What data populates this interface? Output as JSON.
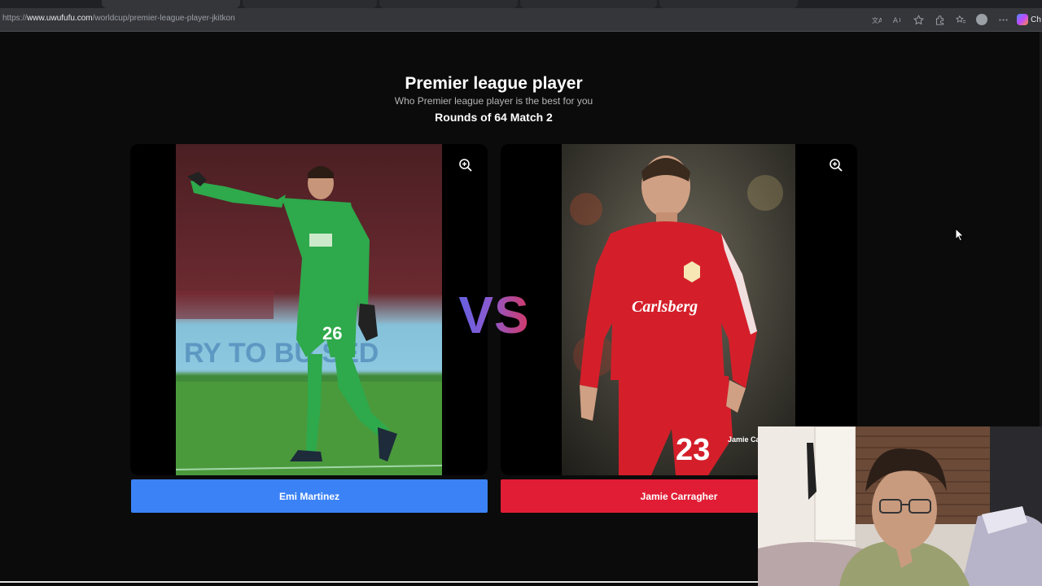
{
  "browser": {
    "url_prefix": "https://",
    "url_host": "www.uwufufu.com",
    "url_path": "/worldcup/premier-league-player-jkitkon",
    "copilot_label": "Ch"
  },
  "header": {
    "title": "Premier league player",
    "subtitle": "Who Premier league player is the best for you",
    "round": "Rounds of 64 Match 2"
  },
  "vs_label": "VS",
  "candidates": [
    {
      "name": "Emi Martinez",
      "shirt_number": "26",
      "kit_color": "#2ea94b",
      "button_color": "#3b82f6"
    },
    {
      "name": "Jamie Carragher",
      "shirt_number": "23",
      "kit_color": "#d41f2a",
      "button_color": "#e11d35",
      "shirt_sponsor": "Carlsberg",
      "caption": "Jamie Ca"
    }
  ]
}
